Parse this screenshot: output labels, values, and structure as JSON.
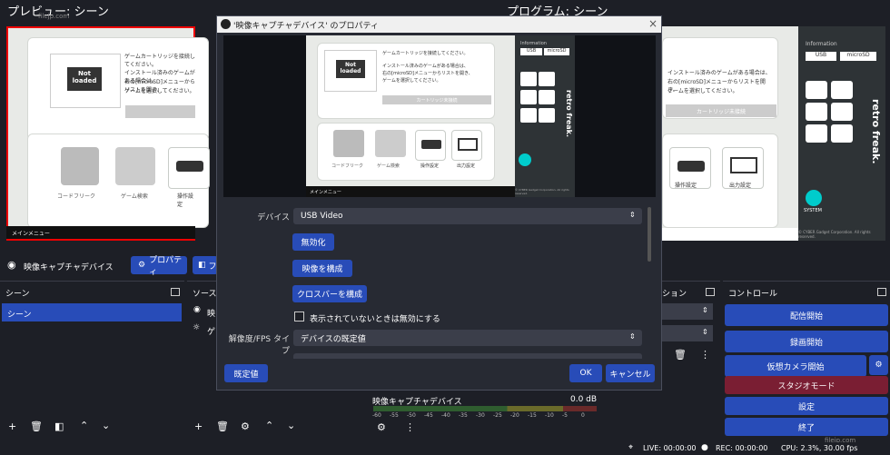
{
  "preview_title": "プレビュー: シーン",
  "program_title": "プログラム: シーン",
  "watermark": "filejp.com",
  "game": {
    "msg": "ゲームカートリッジを接続してください。",
    "msg2a": "インストール済みのゲームがある場合は、",
    "msg2b": "右の[microSD]メニューからリストを開き、",
    "msg2c": "ゲームを選択してください。",
    "not_loaded": "Not loaded",
    "cartridge_btn": "カートリッジ未接続",
    "code_free": "コードフリーク",
    "game_search": "ゲーム検索",
    "op_settings": "操作設定",
    "output_settings": "出力設定",
    "main_menu": "メインメニュー",
    "info": "Information",
    "usb": "USB",
    "microsd": "microSD",
    "brand": "retro freak.",
    "system": "SYSTEM",
    "copyright": "© CYBER Gadget Corporation. All rights reserved."
  },
  "source_bar": {
    "source_name": "映像キャプチャデバイス",
    "properties_label": "プロパティ",
    "filter_label": "フ"
  },
  "scenes": {
    "title": "シーン",
    "items": [
      "シーン"
    ]
  },
  "sources": {
    "title": "ソース",
    "items": [
      "映",
      "ゲ"
    ]
  },
  "transitions": {
    "title": "ション"
  },
  "controls": {
    "title": "コントロール",
    "buttons": [
      "配信開始",
      "録画開始",
      "仮想カメラ開始",
      "スタジオモード",
      "設定",
      "終了"
    ]
  },
  "mixer": {
    "source": "映像キャプチャデバイス",
    "db": "0.0 dB",
    "ticks": [
      "-60",
      "-55",
      "-50",
      "-45",
      "-40",
      "-35",
      "-30",
      "-25",
      "-20",
      "-15",
      "-10",
      "-5",
      "0"
    ]
  },
  "status": {
    "live": "LIVE: 00:00:00",
    "rec": "REC: 00:00:00",
    "cpu": "CPU: 2.3%, 30.00 fps"
  },
  "dialog": {
    "title": "'映像キャプチャデバイス' のプロパティ",
    "device_label": "デバイス",
    "device_value": "USB Video",
    "disable_btn": "無効化",
    "configure_video_btn": "映像を構成",
    "crossbar_btn": "クロスバーを構成",
    "checkbox_label": "表示されていないときは無効にする",
    "resolution_label": "解像度/FPS タイプ",
    "resolution_value": "デバイスの既定値",
    "defaults_btn": "既定値",
    "ok_btn": "OK",
    "cancel_btn": "キャンセル"
  },
  "colors": {
    "accent": "#284cb8",
    "studio": "#7a1e33",
    "bg": "#1d1f26"
  }
}
